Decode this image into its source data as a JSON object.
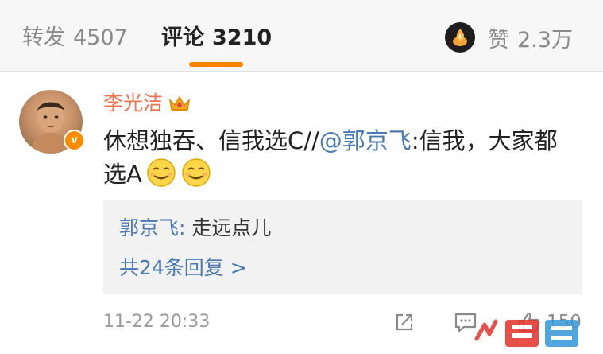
{
  "tabs": {
    "repost": {
      "label": "转发",
      "count": "4507"
    },
    "comment": {
      "label": "评论",
      "count": "3210"
    }
  },
  "likes": {
    "label": "赞",
    "count": "2.3万"
  },
  "comment": {
    "username": "李光洁",
    "text_before": "休想独吞、信我选C//",
    "mention": "@郭京飞",
    "text_after": ":信我，大家都选A",
    "emoji": [
      "smirk-emoji",
      "smirk-emoji"
    ],
    "reply": {
      "author": "郭京飞:",
      "text": " 走远点儿",
      "more": "共24条回复 >"
    },
    "timestamp": "11-22 20:33",
    "like_count": "150"
  },
  "colors": {
    "accent": "#ff8200",
    "username": "#eb7350",
    "link": "#4a7ab4",
    "muted": "#8a8a8a"
  },
  "icons": [
    "flame-like-icon",
    "verified-badge-icon",
    "crown-icon",
    "share-icon",
    "comment-icon",
    "thumbs-up-icon"
  ]
}
